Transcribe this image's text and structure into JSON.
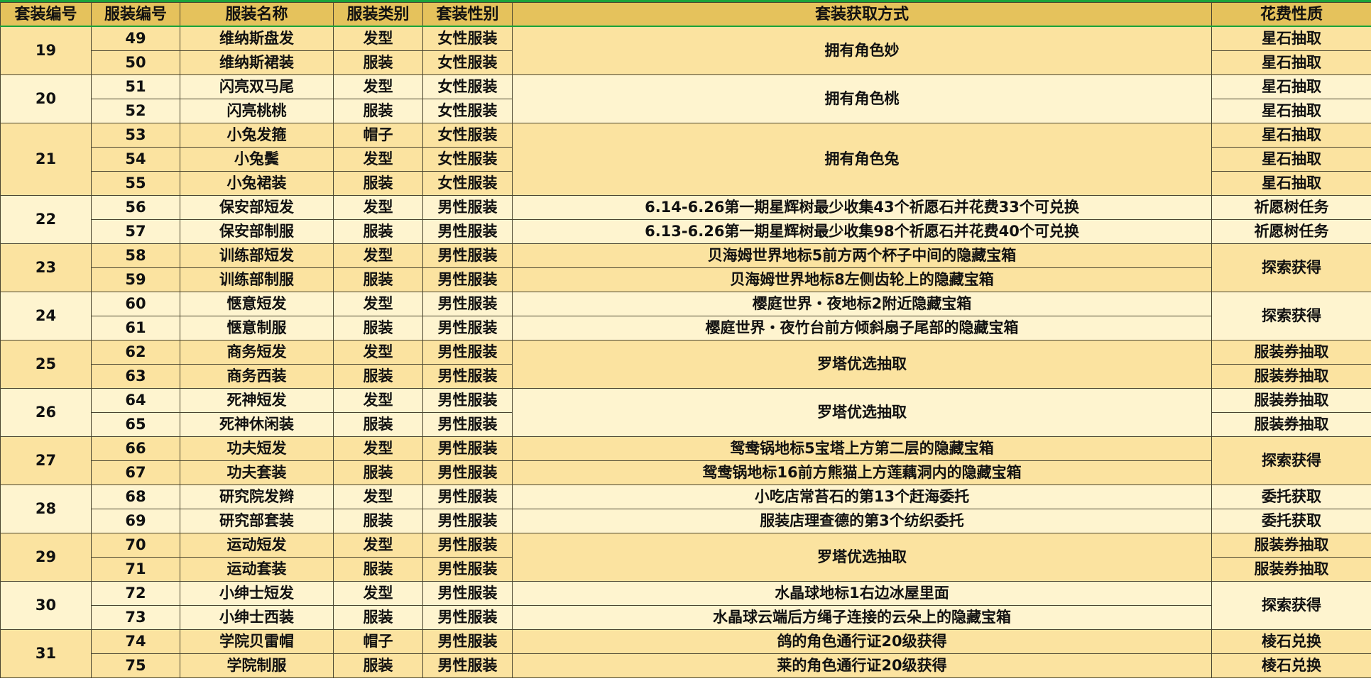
{
  "headers": [
    "套装编号",
    "服装编号",
    "服装名称",
    "服装类别",
    "套装性别",
    "套装获取方式",
    "花费性质"
  ],
  "groups": [
    {
      "set": "19",
      "tone": "dark",
      "source_merged": true,
      "cost_merged": false,
      "items": [
        {
          "no": "49",
          "name": "维纳斯盘发",
          "type": "发型",
          "gender": "女性服装",
          "source": "拥有角色妙",
          "cost": "星石抽取"
        },
        {
          "no": "50",
          "name": "维纳斯裙装",
          "type": "服装",
          "gender": "女性服装",
          "source": "",
          "cost": "星石抽取"
        }
      ]
    },
    {
      "set": "20",
      "tone": "light",
      "source_merged": true,
      "cost_merged": false,
      "items": [
        {
          "no": "51",
          "name": "闪亮双马尾",
          "type": "发型",
          "gender": "女性服装",
          "source": "拥有角色桃",
          "cost": "星石抽取"
        },
        {
          "no": "52",
          "name": "闪亮桃桃",
          "type": "服装",
          "gender": "女性服装",
          "source": "",
          "cost": "星石抽取"
        }
      ]
    },
    {
      "set": "21",
      "tone": "dark",
      "source_merged": true,
      "cost_merged": false,
      "items": [
        {
          "no": "53",
          "name": "小兔发箍",
          "type": "帽子",
          "gender": "女性服装",
          "source": "拥有角色兔",
          "cost": "星石抽取"
        },
        {
          "no": "54",
          "name": "小兔鬓",
          "type": "发型",
          "gender": "女性服装",
          "source": "",
          "cost": "星石抽取"
        },
        {
          "no": "55",
          "name": "小兔裙装",
          "type": "服装",
          "gender": "女性服装",
          "source": "",
          "cost": "星石抽取"
        }
      ]
    },
    {
      "set": "22",
      "tone": "light",
      "source_merged": false,
      "cost_merged": false,
      "items": [
        {
          "no": "56",
          "name": "保安部短发",
          "type": "发型",
          "gender": "男性服装",
          "source": "6.14-6.26第一期星辉树最少收集43个祈愿石并花费33个可兑换",
          "cost": "祈愿树任务"
        },
        {
          "no": "57",
          "name": "保安部制服",
          "type": "服装",
          "gender": "男性服装",
          "source": "6.13-6.26第一期星辉树最少收集98个祈愿石并花费40个可兑换",
          "cost": "祈愿树任务"
        }
      ]
    },
    {
      "set": "23",
      "tone": "dark",
      "source_merged": false,
      "cost_merged": true,
      "items": [
        {
          "no": "58",
          "name": "训练部短发",
          "type": "发型",
          "gender": "男性服装",
          "source": "贝海姆世界地标5前方两个杯子中间的隐藏宝箱",
          "cost": "探索获得"
        },
        {
          "no": "59",
          "name": "训练部制服",
          "type": "服装",
          "gender": "男性服装",
          "source": "贝海姆世界地标8左侧齿轮上的隐藏宝箱",
          "cost": ""
        }
      ]
    },
    {
      "set": "24",
      "tone": "light",
      "source_merged": false,
      "cost_merged": true,
      "items": [
        {
          "no": "60",
          "name": "惬意短发",
          "type": "发型",
          "gender": "男性服装",
          "source": "樱庭世界・夜地标2附近隐藏宝箱",
          "cost": "探索获得"
        },
        {
          "no": "61",
          "name": "惬意制服",
          "type": "服装",
          "gender": "男性服装",
          "source": "樱庭世界・夜竹台前方倾斜扇子尾部的隐藏宝箱",
          "cost": ""
        }
      ]
    },
    {
      "set": "25",
      "tone": "dark",
      "source_merged": true,
      "cost_merged": false,
      "items": [
        {
          "no": "62",
          "name": "商务短发",
          "type": "发型",
          "gender": "男性服装",
          "source": "罗塔优选抽取",
          "cost": "服装券抽取"
        },
        {
          "no": "63",
          "name": "商务西装",
          "type": "服装",
          "gender": "男性服装",
          "source": "",
          "cost": "服装券抽取"
        }
      ]
    },
    {
      "set": "26",
      "tone": "light",
      "source_merged": true,
      "cost_merged": false,
      "items": [
        {
          "no": "64",
          "name": "死神短发",
          "type": "发型",
          "gender": "男性服装",
          "source": "罗塔优选抽取",
          "cost": "服装券抽取"
        },
        {
          "no": "65",
          "name": "死神休闲装",
          "type": "服装",
          "gender": "男性服装",
          "source": "",
          "cost": "服装券抽取"
        }
      ]
    },
    {
      "set": "27",
      "tone": "dark",
      "source_merged": false,
      "cost_merged": true,
      "items": [
        {
          "no": "66",
          "name": "功夫短发",
          "type": "发型",
          "gender": "男性服装",
          "source": "鸳鸯锅地标5宝塔上方第二层的隐藏宝箱",
          "cost": "探索获得"
        },
        {
          "no": "67",
          "name": "功夫套装",
          "type": "服装",
          "gender": "男性服装",
          "source": "鸳鸯锅地标16前方熊猫上方莲藕洞内的隐藏宝箱",
          "cost": ""
        }
      ]
    },
    {
      "set": "28",
      "tone": "light",
      "source_merged": false,
      "cost_merged": false,
      "items": [
        {
          "no": "68",
          "name": "研究院发辫",
          "type": "发型",
          "gender": "男性服装",
          "source": "小吃店常苔石的第13个赶海委托",
          "cost": "委托获取"
        },
        {
          "no": "69",
          "name": "研究部套装",
          "type": "服装",
          "gender": "男性服装",
          "source": "服装店理查德的第3个纺织委托",
          "cost": "委托获取"
        }
      ]
    },
    {
      "set": "29",
      "tone": "dark",
      "source_merged": true,
      "cost_merged": false,
      "items": [
        {
          "no": "70",
          "name": "运动短发",
          "type": "发型",
          "gender": "男性服装",
          "source": "罗塔优选抽取",
          "cost": "服装券抽取"
        },
        {
          "no": "71",
          "name": "运动套装",
          "type": "服装",
          "gender": "男性服装",
          "source": "",
          "cost": "服装券抽取"
        }
      ]
    },
    {
      "set": "30",
      "tone": "light",
      "source_merged": false,
      "cost_merged": true,
      "items": [
        {
          "no": "72",
          "name": "小绅士短发",
          "type": "发型",
          "gender": "男性服装",
          "source": "水晶球地标1右边冰屋里面",
          "cost": "探索获得"
        },
        {
          "no": "73",
          "name": "小绅士西装",
          "type": "服装",
          "gender": "男性服装",
          "source": "水晶球云端后方绳子连接的云朵上的隐藏宝箱",
          "cost": ""
        }
      ]
    },
    {
      "set": "31",
      "tone": "dark",
      "source_merged": false,
      "cost_merged": false,
      "items": [
        {
          "no": "74",
          "name": "学院贝雷帽",
          "type": "帽子",
          "gender": "男性服装",
          "source": "鸽的角色通行证20级获得",
          "cost": "棱石兑换"
        },
        {
          "no": "75",
          "name": "学院制服",
          "type": "服装",
          "gender": "男性服装",
          "source": "莱的角色通行证20级获得",
          "cost": "棱石兑换"
        }
      ]
    }
  ]
}
